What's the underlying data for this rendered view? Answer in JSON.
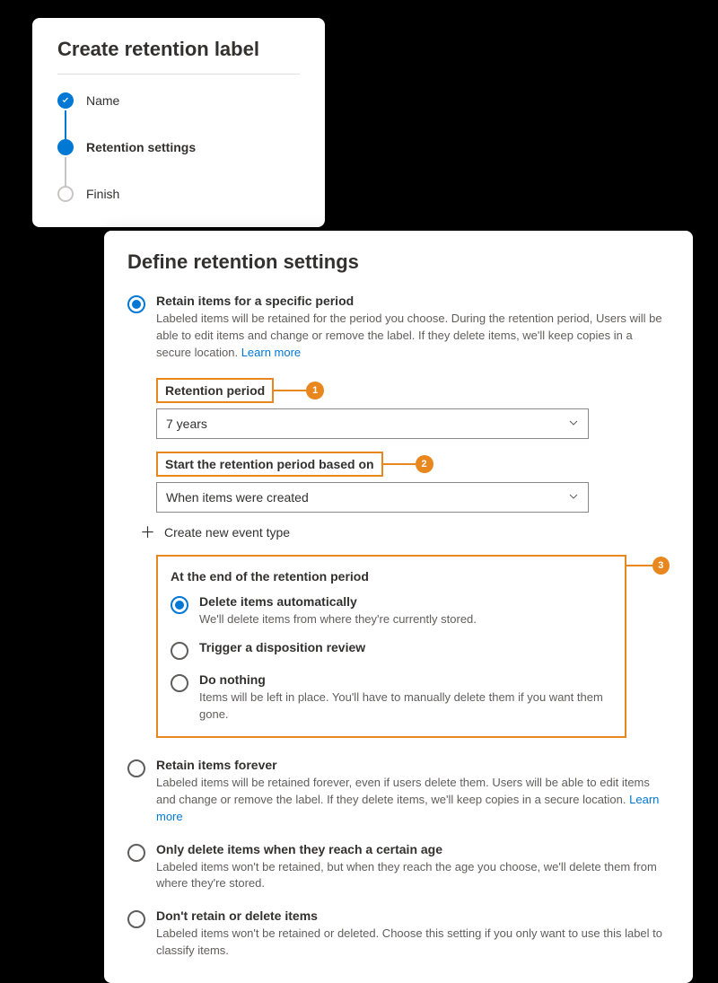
{
  "wizard": {
    "title": "Create retention label",
    "steps": [
      {
        "label": "Name"
      },
      {
        "label": "Retention settings"
      },
      {
        "label": "Finish"
      }
    ]
  },
  "settings": {
    "title": "Define retention settings",
    "options": {
      "specific": {
        "label": "Retain items for a specific period",
        "desc": "Labeled items will be retained for the period you choose. During the retention period, Users will be able to edit items and change or remove the label. If they delete items, we'll keep copies in a secure location.",
        "learn_more": "Learn more"
      },
      "forever": {
        "label": "Retain items forever",
        "desc": "Labeled items will be retained forever, even if users delete them. Users will be able to edit items and change or remove the label. If they delete items, we'll keep copies in a secure location.",
        "learn_more": "Learn more"
      },
      "only_delete": {
        "label": "Only delete items when they reach a certain age",
        "desc": "Labeled items won't be retained, but when they reach the age you choose, we'll delete them from where they're stored."
      },
      "dont": {
        "label": "Don't retain or delete items",
        "desc": "Labeled items won't be retained or deleted. Choose this setting if you only want to use this label to classify items."
      }
    },
    "period": {
      "label": "Retention period",
      "value": "7 years"
    },
    "start": {
      "label": "Start the retention period based on",
      "value": "When items were created"
    },
    "create_event": "Create new event type",
    "end": {
      "title": "At the end of the retention period",
      "delete": {
        "label": "Delete items automatically",
        "desc": "We'll delete items from where they're currently stored."
      },
      "disposition": {
        "label": "Trigger a disposition review"
      },
      "nothing": {
        "label": "Do nothing",
        "desc": "Items will be left in place. You'll have to manually delete them if you want them gone."
      }
    },
    "callouts": {
      "c1": "1",
      "c2": "2",
      "c3": "3"
    }
  }
}
